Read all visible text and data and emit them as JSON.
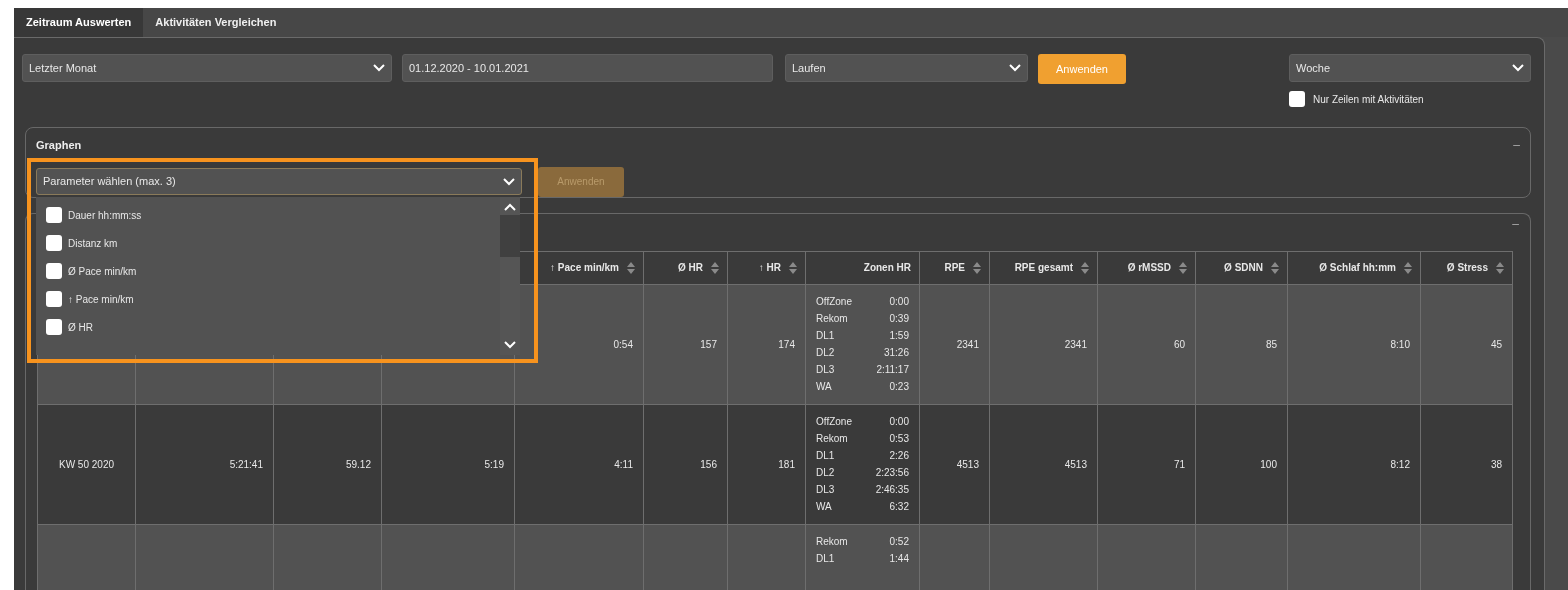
{
  "tabs": [
    {
      "label": "Zeitraum Auswerten",
      "selected": true
    },
    {
      "label": "Aktivitäten Vergleichen",
      "selected": false
    }
  ],
  "filters": {
    "range": {
      "value": "Letzter Monat"
    },
    "dates": {
      "value": "01.12.2020 - 10.01.2021"
    },
    "sport": {
      "value": "Laufen"
    },
    "apply": "Anwenden",
    "grouping": {
      "value": "Woche"
    },
    "only_active": {
      "label": "Nur Zeilen mit Aktivitäten",
      "checked": false
    }
  },
  "graphs": {
    "title": "Graphen",
    "collapse": "–",
    "parameter_select": {
      "value": "Parameter wählen (max. 3)",
      "expanded": true
    },
    "apply": {
      "label": "Anwenden",
      "disabled": true
    },
    "options": [
      {
        "label": "Dauer hh:mm:ss",
        "checked": false
      },
      {
        "label": "Distanz km",
        "checked": false
      },
      {
        "label": "Ø Pace min/km",
        "checked": false
      },
      {
        "label": "↑ Pace min/km",
        "checked": false
      },
      {
        "label": "Ø HR",
        "checked": false
      }
    ]
  },
  "table_panel": {
    "collapse": "–"
  },
  "table": {
    "columns": [
      {
        "label": "↑ Pace min/km",
        "sortable": true
      },
      {
        "label": "Ø HR",
        "sortable": true
      },
      {
        "label": "↑ HR",
        "sortable": true
      },
      {
        "label": "Zonen HR",
        "sortable": false
      },
      {
        "label": "RPE",
        "sortable": true
      },
      {
        "label": "RPE gesamt",
        "sortable": true
      },
      {
        "label": "Ø rMSSD",
        "sortable": true
      },
      {
        "label": "Ø SDNN",
        "sortable": true
      },
      {
        "label": "Ø Schlaf hh:mm",
        "sortable": true
      },
      {
        "label": "Ø Stress",
        "sortable": true
      }
    ],
    "rows": [
      {
        "lead": [],
        "values": [
          "0:54",
          "157",
          "174"
        ],
        "zones": [
          {
            "zone": "OffZone",
            "time": "0:00"
          },
          {
            "zone": "Rekom",
            "time": "0:39"
          },
          {
            "zone": "DL1",
            "time": "1:59"
          },
          {
            "zone": "DL2",
            "time": "31:26"
          },
          {
            "zone": "DL3",
            "time": "2:11:17"
          },
          {
            "zone": "WA",
            "time": "0:23"
          }
        ],
        "rest": [
          "2341",
          "2341",
          "60",
          "85",
          "8:10",
          "45"
        ]
      },
      {
        "lead": [
          "KW 50 2020",
          "5:21:41",
          "59.12",
          "5:19"
        ],
        "values": [
          "4:11",
          "156",
          "181"
        ],
        "zones": [
          {
            "zone": "OffZone",
            "time": "0:00"
          },
          {
            "zone": "Rekom",
            "time": "0:53"
          },
          {
            "zone": "DL1",
            "time": "2:26"
          },
          {
            "zone": "DL2",
            "time": "2:23:56"
          },
          {
            "zone": "DL3",
            "time": "2:46:35"
          },
          {
            "zone": "WA",
            "time": "6:32"
          }
        ],
        "rest": [
          "4513",
          "4513",
          "71",
          "100",
          "8:12",
          "38"
        ]
      },
      {
        "lead": [],
        "values": [],
        "zones": [
          {
            "zone": "Rekom",
            "time": "0:52"
          },
          {
            "zone": "DL1",
            "time": "1:44"
          }
        ],
        "rest": []
      }
    ]
  }
}
